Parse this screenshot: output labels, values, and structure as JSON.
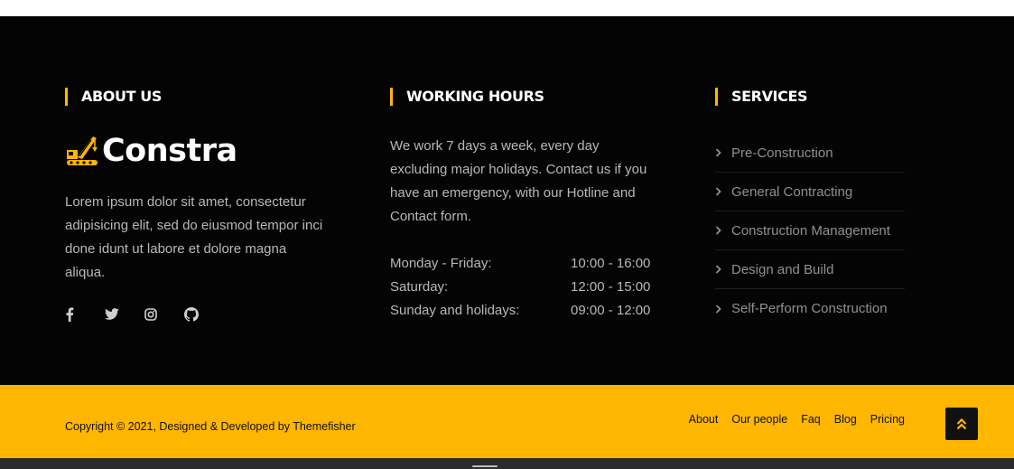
{
  "about": {
    "title": "ABOUT US",
    "logo_text": "Constra",
    "text": "Lorem ipsum dolor sit amet, consectetur adipisicing elit, sed do eiusmod tempor inci done idunt ut labore et dolore magna aliqua.",
    "social": [
      "facebook-icon",
      "twitter-icon",
      "instagram-icon",
      "github-icon"
    ]
  },
  "hours": {
    "title": "WORKING HOURS",
    "text": "We work 7 days a week, every day excluding major holidays. Contact us if you have an emergency, with our Hotline and Contact form.",
    "rows": [
      {
        "day": "Monday - Friday:",
        "time": "10:00 - 16:00"
      },
      {
        "day": "Saturday:",
        "time": "12:00 - 15:00"
      },
      {
        "day": "Sunday and holidays:",
        "time": "09:00 - 12:00"
      }
    ]
  },
  "services": {
    "title": "SERVICES",
    "items": [
      "Pre-Construction",
      "General Contracting",
      "Construction Management",
      "Design and Build",
      "Self-Perform Construction"
    ]
  },
  "copyright": {
    "text": "Copyright © 2021, Designed & Developed by Themefisher",
    "menu": [
      "About",
      "Our people",
      "Faq",
      "Blog",
      "Pricing"
    ],
    "back_to_top_icon": "double-chevron-up-icon"
  },
  "colors": {
    "accent": "#ffb600",
    "footer_bg": "#040404"
  }
}
